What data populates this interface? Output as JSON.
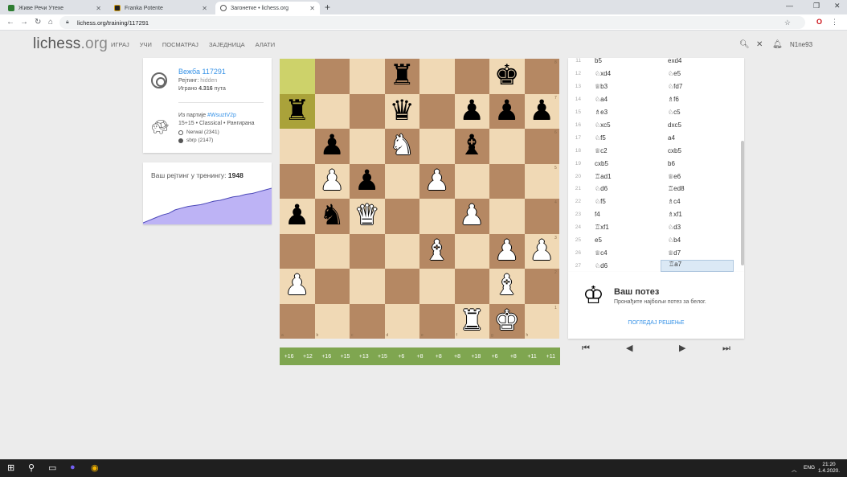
{
  "browser": {
    "tabs": [
      {
        "title": "Живе Речи Утехе",
        "active": false,
        "favicon_color": "#2e7d32"
      },
      {
        "title": "Franka Potente",
        "active": false,
        "favicon_color": "#222222"
      },
      {
        "title": "Загонетке • lichess.org",
        "active": true,
        "favicon_color": "#ffffff"
      }
    ],
    "url": "lichess.org/training/117291"
  },
  "header": {
    "logo_main": "lichess",
    "logo_tld": ".org",
    "nav": [
      "ИГРАЈ",
      "УЧИ",
      "ПОСМАТРАЈ",
      "ЗАЈЕДНИЦА",
      "АЛАТИ"
    ],
    "username": "N1ne93"
  },
  "puzzle": {
    "title": "Вежба 117291",
    "rating_label": "Рејтинг:",
    "rating_value": "hidden",
    "played_prefix": "Играно",
    "played_count": "4.316",
    "played_suffix": "пута",
    "from_game_prefix": "Из партије",
    "game_link": "#WsuztV2p",
    "game_meta": "15+15 • Classical • Рангирана",
    "white_player": "Nerwal (2341)",
    "black_player": "sbrp (2147)"
  },
  "training_rating": {
    "label": "Ваш рејтинг у тренингу:",
    "value": "1948",
    "chart_color": "#bdb3f5",
    "history": [
      0,
      3,
      6,
      9,
      11,
      15,
      17,
      19,
      20,
      21,
      23,
      25,
      26,
      28,
      30,
      31,
      33,
      34,
      36,
      38,
      40
    ]
  },
  "board": {
    "ranks": [
      "8",
      "7",
      "6",
      "5",
      "4",
      "3",
      "2",
      "1"
    ],
    "files": [
      "a",
      "b",
      "c",
      "d",
      "e",
      "f",
      "g",
      "h"
    ],
    "pieces": [
      {
        "square": "d8",
        "glyph": "♜",
        "color": "b",
        "name": "black-rook"
      },
      {
        "square": "g8",
        "glyph": "♚",
        "color": "b",
        "name": "black-king"
      },
      {
        "square": "a7",
        "glyph": "♜",
        "color": "b",
        "name": "black-rook"
      },
      {
        "square": "d7",
        "glyph": "♛",
        "color": "b",
        "name": "black-queen"
      },
      {
        "square": "f7",
        "glyph": "♟",
        "color": "b",
        "name": "black-pawn"
      },
      {
        "square": "g7",
        "glyph": "♟",
        "color": "b",
        "name": "black-pawn"
      },
      {
        "square": "h7",
        "glyph": "♟",
        "color": "b",
        "name": "black-pawn"
      },
      {
        "square": "b6",
        "glyph": "♟",
        "color": "b",
        "name": "black-pawn"
      },
      {
        "square": "d6",
        "glyph": "♞",
        "color": "w",
        "name": "white-knight"
      },
      {
        "square": "f6",
        "glyph": "♝",
        "color": "b",
        "name": "black-bishop"
      },
      {
        "square": "b5",
        "glyph": "♟",
        "color": "w",
        "name": "white-pawn"
      },
      {
        "square": "c5",
        "glyph": "♟",
        "color": "b",
        "name": "black-pawn"
      },
      {
        "square": "e5",
        "glyph": "♟",
        "color": "w",
        "name": "white-pawn"
      },
      {
        "square": "a4",
        "glyph": "♟",
        "color": "b",
        "name": "black-pawn"
      },
      {
        "square": "b4",
        "glyph": "♞",
        "color": "b",
        "name": "black-knight"
      },
      {
        "square": "c4",
        "glyph": "♛",
        "color": "w",
        "name": "white-queen"
      },
      {
        "square": "f4",
        "glyph": "♟",
        "color": "w",
        "name": "white-pawn"
      },
      {
        "square": "e3",
        "glyph": "♝",
        "color": "w",
        "name": "white-bishop"
      },
      {
        "square": "g3",
        "glyph": "♟",
        "color": "w",
        "name": "white-pawn"
      },
      {
        "square": "h3",
        "glyph": "♟",
        "color": "w",
        "name": "white-pawn"
      },
      {
        "square": "a2",
        "glyph": "♟",
        "color": "w",
        "name": "white-pawn"
      },
      {
        "square": "g2",
        "glyph": "♝",
        "color": "w",
        "name": "white-bishop"
      },
      {
        "square": "f1",
        "glyph": "♜",
        "color": "w",
        "name": "white-rook"
      },
      {
        "square": "g1",
        "glyph": "♚",
        "color": "w",
        "name": "white-king"
      }
    ],
    "highlight": [
      "a8",
      "a7"
    ]
  },
  "eval": [
    "+16",
    "+12",
    "+16",
    "+15",
    "+13",
    "+15",
    "+6",
    "+8",
    "+8",
    "+8",
    "+18",
    "+6",
    "+8",
    "+11",
    "+11"
  ],
  "moves": [
    {
      "num": "11",
      "white": "b5",
      "black": "exd4"
    },
    {
      "num": "12",
      "white": "♘xd4",
      "black": "♘e5"
    },
    {
      "num": "13",
      "white": "♕b3",
      "black": "♘fd7"
    },
    {
      "num": "14",
      "white": "♘a4",
      "black": "♗f6"
    },
    {
      "num": "15",
      "white": "♗e3",
      "black": "♘c5"
    },
    {
      "num": "16",
      "white": "♘xc5",
      "black": "dxc5"
    },
    {
      "num": "17",
      "white": "♘f5",
      "black": "a4"
    },
    {
      "num": "18",
      "white": "♕c2",
      "black": "cxb5"
    },
    {
      "num": "19",
      "white": "cxb5",
      "black": "b6"
    },
    {
      "num": "20",
      "white": "♖ad1",
      "black": "♕e6"
    },
    {
      "num": "21",
      "white": "♘d6",
      "black": "♖ed8"
    },
    {
      "num": "22",
      "white": "♘f5",
      "black": "♗c4"
    },
    {
      "num": "23",
      "white": "f4",
      "black": "♗xf1"
    },
    {
      "num": "24",
      "white": "♖xf1",
      "black": "♘d3"
    },
    {
      "num": "25",
      "white": "e5",
      "black": "♘b4"
    },
    {
      "num": "26",
      "white": "♕c4",
      "black": "♕d7"
    },
    {
      "num": "27",
      "white": "♘d6",
      "black": "♖a7"
    }
  ],
  "prompt": {
    "title": "Ваш потез",
    "subtitle": "Пронађите најбољи потез за белог.",
    "view_solution": "ПОГЛЕДАЈ РЕШЕЊЕ"
  },
  "controls": {
    "first": "⏮",
    "prev": "◀",
    "next": "▶",
    "last": "⏭"
  },
  "taskbar": {
    "lang": "ENG",
    "time": "21:20",
    "date": "1.4.2020."
  }
}
